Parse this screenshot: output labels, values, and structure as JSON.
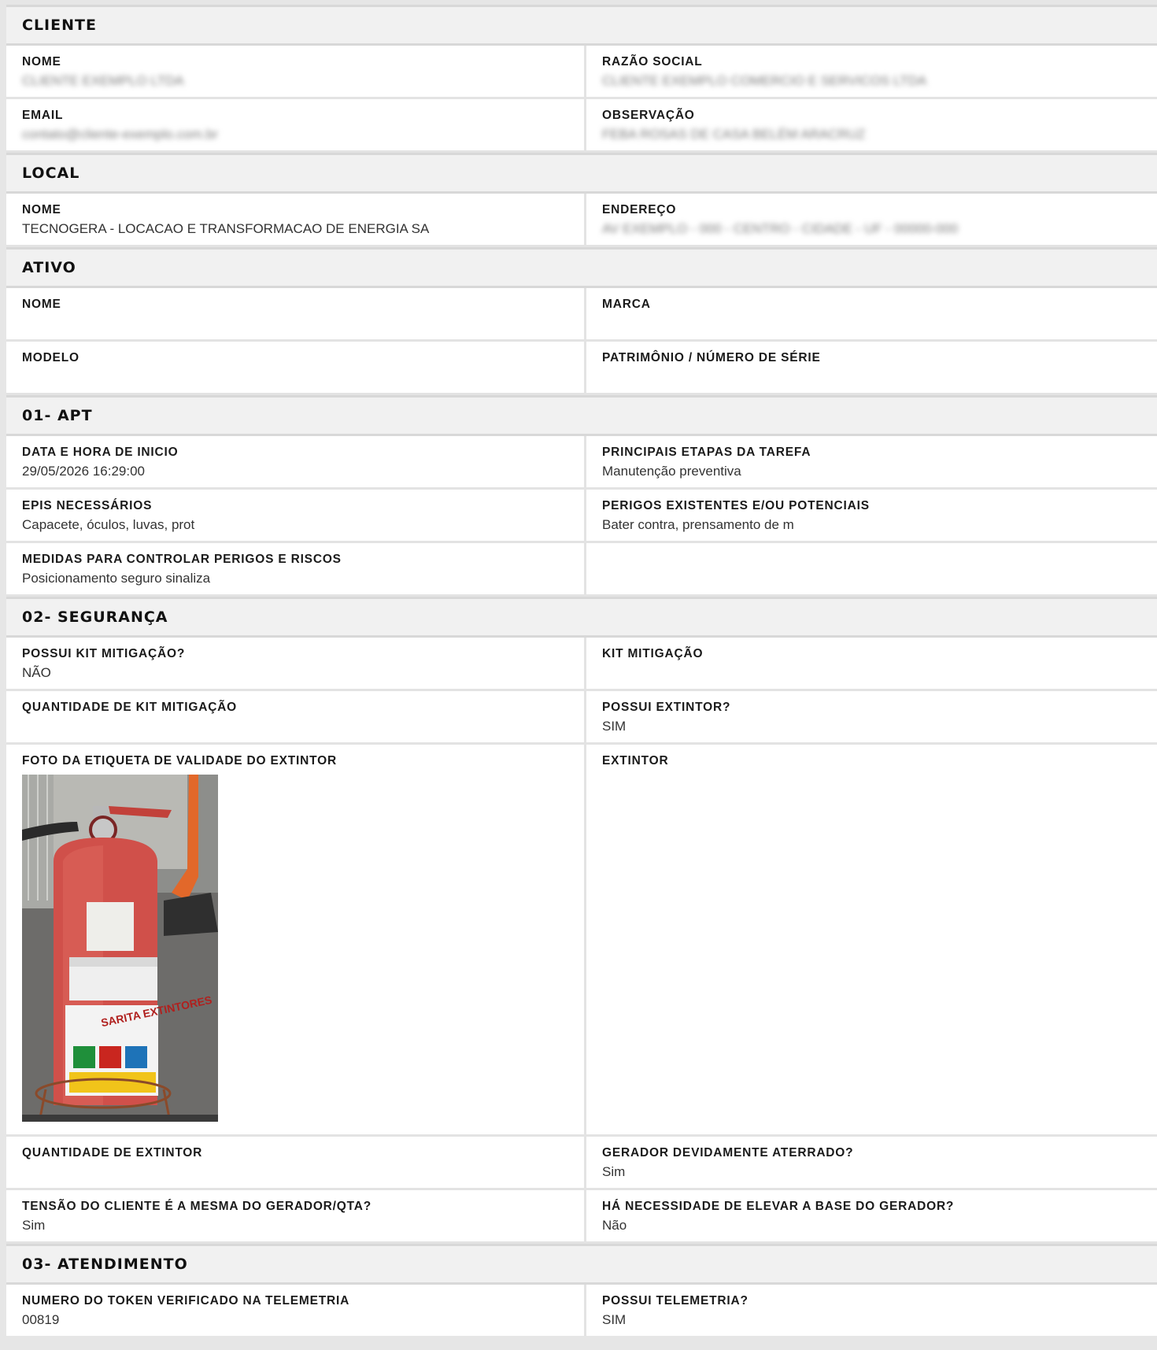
{
  "sections": {
    "cliente": {
      "title": "CLIENTE",
      "nome_label": "NOME",
      "nome_value": "CLIENTE EXEMPLO LTDA",
      "razao_label": "RAZÃO SOCIAL",
      "razao_value": "CLIENTE EXEMPLO COMERCIO E SERVICOS LTDA",
      "email_label": "EMAIL",
      "email_value": "contato@cliente-exemplo.com.br",
      "obs_label": "OBSERVAÇÃO",
      "obs_value": "FEBA ROSAS DE CASA BELÉM ARACRUZ"
    },
    "local": {
      "title": "LOCAL",
      "nome_label": "NOME",
      "nome_value": "TECNOGERA - LOCACAO E TRANSFORMACAO DE ENERGIA SA",
      "endereco_label": "ENDEREÇO",
      "endereco_value": "AV EXEMPLO - 000 - CENTRO - CIDADE - UF - 00000-000"
    },
    "ativo": {
      "title": "ATIVO",
      "nome_label": "NOME",
      "nome_value": "",
      "marca_label": "MARCA",
      "marca_value": "",
      "modelo_label": "MODELO",
      "modelo_value": "",
      "patrimonio_label": "PATRIMÔNIO / NÚMERO DE SÉRIE",
      "patrimonio_value": ""
    },
    "apt": {
      "title": "01- APT",
      "data_label": "DATA E HORA DE INICIO",
      "data_value": "29/05/2026 16:29:00",
      "etapas_label": "PRINCIPAIS ETAPAS DA TAREFA",
      "etapas_value": "Manutenção preventiva",
      "epis_label": "EPIS NECESSÁRIOS",
      "epis_value": "Capacete, óculos,  luvas, prot",
      "perigos_label": "PERIGOS EXISTENTES E/OU POTENCIAIS",
      "perigos_value": "Bater contra, prensamento de m",
      "medidas_label": "MEDIDAS PARA CONTROLAR PERIGOS E RISCOS",
      "medidas_value": "Posicionamento seguro sinaliza"
    },
    "seguranca": {
      "title": "02- SEGURANÇA",
      "possui_kit_label": "POSSUI KIT MITIGAÇÃO?",
      "possui_kit_value": "NÃO",
      "kit_label": "KIT MITIGAÇÃO",
      "kit_value": "",
      "qtd_kit_label": "QUANTIDADE DE KIT MITIGAÇÃO",
      "qtd_kit_value": "",
      "possui_ext_label": "POSSUI EXTINTOR?",
      "possui_ext_value": "SIM",
      "foto_label": "FOTO DA ETIQUETA DE VALIDADE DO EXTINTOR",
      "foto_image": "fire-extinguisher-photo",
      "foto_image_text": "SARITA EXTINTORES",
      "ext_label": "EXTINTOR",
      "ext_value": "",
      "qtd_ext_label": "QUANTIDADE DE EXTINTOR",
      "qtd_ext_value": "",
      "aterrado_label": "GERADOR DEVIDAMENTE ATERRADO?",
      "aterrado_value": "Sim",
      "tensao_label": "TENSÃO DO CLIENTE É A MESMA DO GERADOR/QTA?",
      "tensao_value": "Sim",
      "elevar_label": "HÁ NECESSIDADE DE ELEVAR A BASE DO GERADOR?",
      "elevar_value": "Não"
    },
    "atendimento": {
      "title": "03- ATENDIMENTO",
      "token_label": "NUMERO DO TOKEN VERIFICADO NA TELEMETRIA",
      "token_value": "00819",
      "telemetria_label": "POSSUI TELEMETRIA?",
      "telemetria_value": "SIM"
    }
  }
}
